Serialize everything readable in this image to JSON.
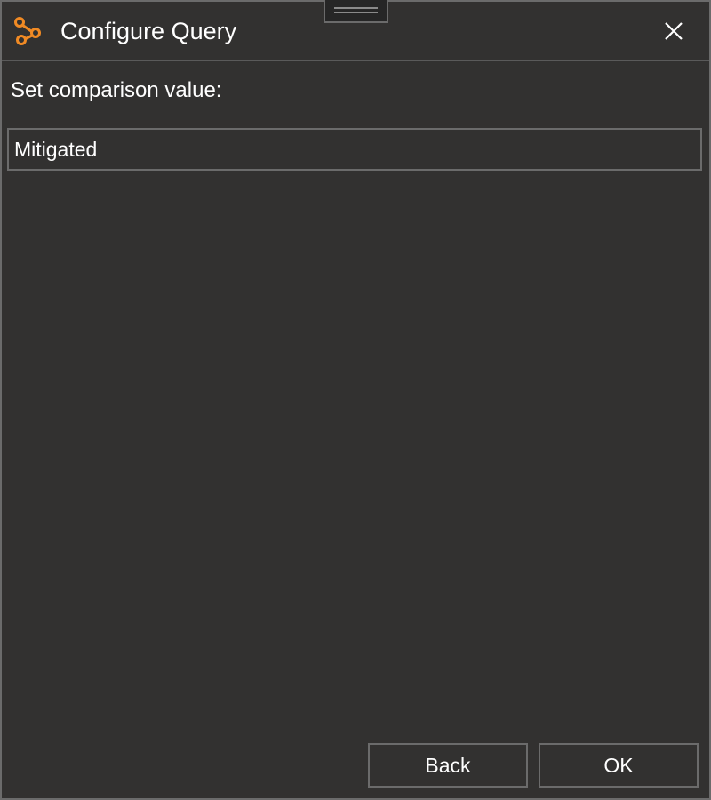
{
  "window": {
    "title": "Configure Query",
    "icon": "query-path-icon",
    "accent_color": "#f08a24",
    "close_icon": "close-icon",
    "drag_handle_icon": "drag-handle-icon"
  },
  "form": {
    "prompt": "Set comparison value:",
    "value": "Mitigated"
  },
  "buttons": {
    "back_label": "Back",
    "ok_label": "OK"
  }
}
